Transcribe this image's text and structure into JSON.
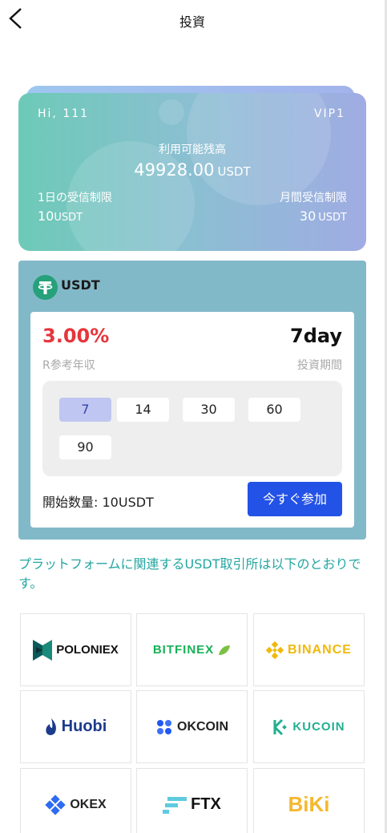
{
  "header": {
    "title": "投資"
  },
  "balance": {
    "greeting": "Hi, 111",
    "vip": "VIP1",
    "available_label": "利用可能残高",
    "available_value": "49928.00",
    "available_unit": "USDT",
    "daily_limit_label": "1日の受信制限",
    "daily_limit_value": "10",
    "daily_limit_unit": "USDT",
    "monthly_limit_label": "月間受信制限",
    "monthly_limit_value": "30",
    "monthly_limit_unit": "USDT"
  },
  "product": {
    "coin": "USDT",
    "rate": "3.00%",
    "rate_label": "R参考年収",
    "term": "7day",
    "term_label": "投資期間",
    "options": [
      "7",
      "14",
      "30",
      "60",
      "90"
    ],
    "selected_option": "7",
    "start_label": "開始数量:",
    "start_value": "10USDT",
    "join_label": "今すぐ参加"
  },
  "info_text": "プラットフォームに関連するUSDT取引所は以下のとおりです。",
  "exchanges": [
    "POLONIEX",
    "BITFINEX",
    "BINANCE",
    "Huobi",
    "OKCOIN",
    "KUCOIN",
    "OKEX",
    "FTX",
    "BiKi"
  ],
  "colors": {
    "accent": "#2352e6",
    "rate": "#e6353c",
    "info": "#23a6a0",
    "panel": "#82b9c8",
    "selected_option": "#bfc6f1"
  }
}
